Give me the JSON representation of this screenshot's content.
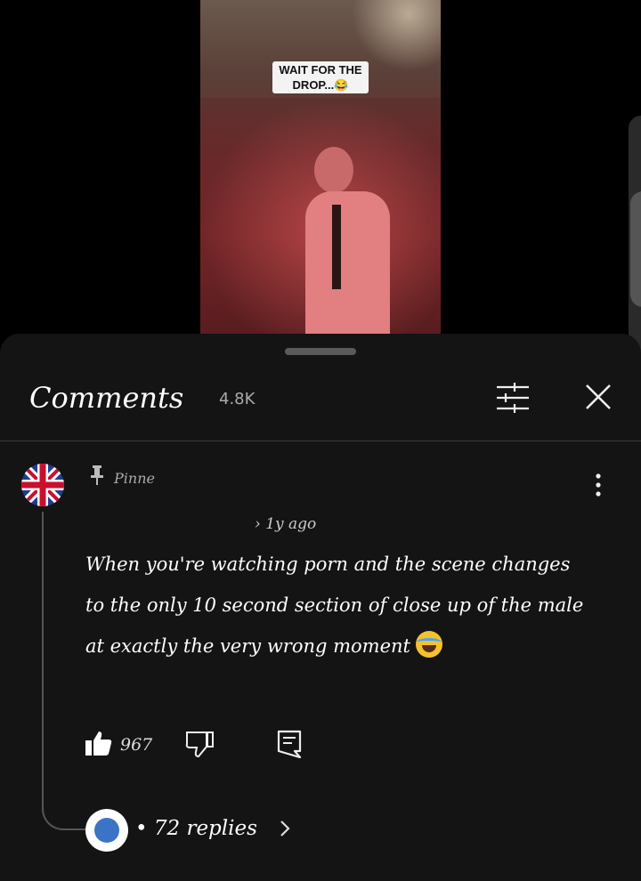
{
  "video": {
    "caption": "WAIT FOR THE DROP...😂"
  },
  "comments_sheet": {
    "title": "Comments",
    "count": "4.8K"
  },
  "comment": {
    "pinned_label": "Pinne",
    "time": "› 1y ago",
    "text": "When you're watching porn and the scene changes to the only 10 second section of close up of the male at exactly the very wrong moment",
    "likes": "967",
    "replies_label": "• 72 replies"
  },
  "icons": {
    "filter": "sliders-icon",
    "close": "close-icon",
    "pin": "pin-icon",
    "more": "more-vert-icon",
    "like": "thumbs-up-icon",
    "dislike": "thumbs-down-icon",
    "reply": "comment-icon",
    "chevron": "chevron-right-icon"
  },
  "colors": {
    "sheet_bg": "#141414",
    "text": "#ffffff",
    "muted": "#aaaaaa"
  }
}
